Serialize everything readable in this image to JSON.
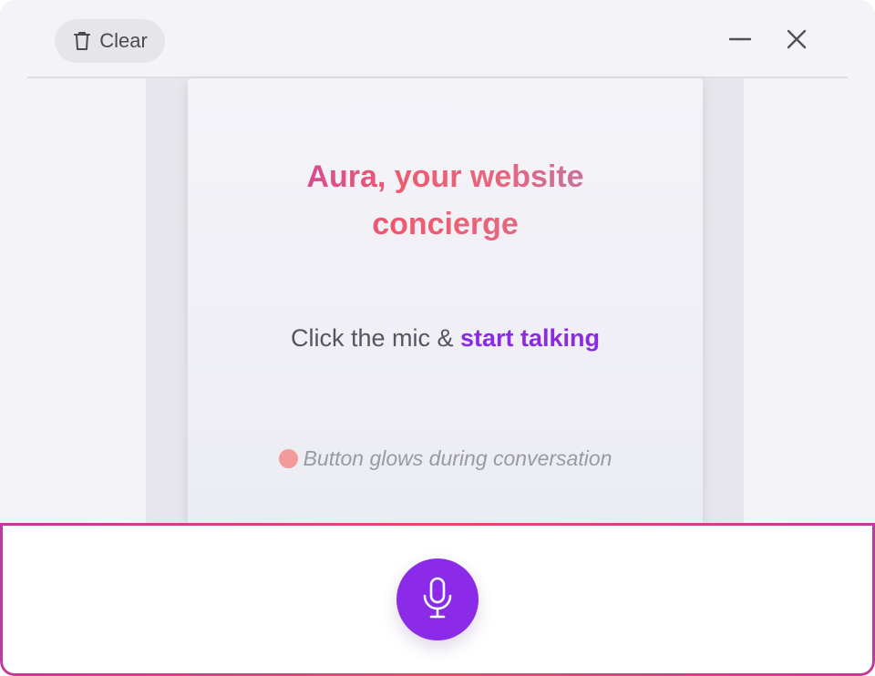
{
  "toolbar": {
    "clear_label": "Clear",
    "clear_icon": "trash-icon",
    "minimize_icon": "minimize-icon",
    "close_icon": "close-icon"
  },
  "card": {
    "headline_line1": "Aura, your website",
    "headline_line2": "concierge",
    "prompt_prefix": "Click the mic & ",
    "prompt_accent": "start talking",
    "hint_text": "Button glows during conversation",
    "hint_dot_color": "#f39a9a"
  },
  "mic": {
    "icon": "microphone-icon",
    "color": "#8b2be8"
  },
  "colors": {
    "accent": "#8a2be2",
    "gradient_start": "#b43bc2",
    "gradient_mid": "#ee5a6e",
    "gradient_end": "#9b82c6"
  }
}
